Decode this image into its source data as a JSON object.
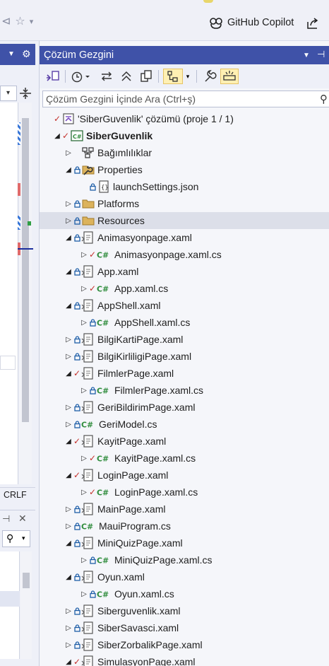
{
  "top": {
    "copilot_label": "GitHub Copilot"
  },
  "left": {
    "footer_text": "CRLF"
  },
  "explorer": {
    "title": "Çözüm Gezgini",
    "search_placeholder": "Çözüm Gezgini İçinde Ara (Ctrl+ş)",
    "colors": {
      "header_bg": "#3f52a8",
      "check": "#c4302b",
      "lock": "#1f5fa8",
      "csharp": "#2f8c3c",
      "active_tool": "#fff0b3"
    },
    "toolbar": [
      {
        "name": "switch-views-icon"
      },
      {
        "name": "history-icon"
      },
      {
        "name": "sync-icon"
      },
      {
        "name": "collapse-all-icon"
      },
      {
        "name": "copy-icon"
      },
      {
        "name": "show-all-files-icon",
        "active": true
      },
      {
        "name": "properties-wrench-icon"
      },
      {
        "name": "preview-selected-icon",
        "active": true
      }
    ],
    "tree": [
      {
        "label": "'SiberGuvenlik' çözümü (proje 1 / 1)",
        "level": 0,
        "expander": "",
        "status": "check",
        "icon": "solution"
      },
      {
        "label": "SiberGuvenlik",
        "level": 1,
        "expander": "expanded",
        "status": "check",
        "icon": "csproj",
        "bold": true
      },
      {
        "label": "Bağımlılıklar",
        "level": 2,
        "expander": "collapsed",
        "status": "",
        "icon": "dependencies"
      },
      {
        "label": "Properties",
        "level": 2,
        "expander": "expanded",
        "status": "lock",
        "icon": "properties-folder"
      },
      {
        "label": "launchSettings.json",
        "level": 3,
        "expander": "",
        "status": "lock",
        "icon": "json"
      },
      {
        "label": "Platforms",
        "level": 2,
        "expander": "collapsed",
        "status": "lock",
        "icon": "folder"
      },
      {
        "label": "Resources",
        "level": 2,
        "expander": "collapsed",
        "status": "lock",
        "icon": "folder",
        "selected": true
      },
      {
        "label": "Animasyonpage.xaml",
        "level": 2,
        "expander": "expanded",
        "status": "lock",
        "icon": "xaml"
      },
      {
        "label": "Animasyonpage.xaml.cs",
        "level": 3,
        "expander": "collapsed",
        "status": "check",
        "icon": "cs"
      },
      {
        "label": "App.xaml",
        "level": 2,
        "expander": "expanded",
        "status": "lock",
        "icon": "xaml"
      },
      {
        "label": "App.xaml.cs",
        "level": 3,
        "expander": "collapsed",
        "status": "check",
        "icon": "cs"
      },
      {
        "label": "AppShell.xaml",
        "level": 2,
        "expander": "expanded",
        "status": "lock",
        "icon": "xaml"
      },
      {
        "label": "AppShell.xaml.cs",
        "level": 3,
        "expander": "collapsed",
        "status": "lock",
        "icon": "cs"
      },
      {
        "label": "BilgiKartiPage.xaml",
        "level": 2,
        "expander": "collapsed",
        "status": "lock",
        "icon": "xaml"
      },
      {
        "label": "BilgiKirliligiPage.xaml",
        "level": 2,
        "expander": "collapsed",
        "status": "lock",
        "icon": "xaml"
      },
      {
        "label": "FilmlerPage.xaml",
        "level": 2,
        "expander": "expanded",
        "status": "check",
        "icon": "xaml"
      },
      {
        "label": "FilmlerPage.xaml.cs",
        "level": 3,
        "expander": "collapsed",
        "status": "lock",
        "icon": "cs"
      },
      {
        "label": "GeriBildirimPage.xaml",
        "level": 2,
        "expander": "collapsed",
        "status": "lock",
        "icon": "xaml"
      },
      {
        "label": "GeriModel.cs",
        "level": 2,
        "expander": "collapsed",
        "status": "lock",
        "icon": "cs"
      },
      {
        "label": "KayitPage.xaml",
        "level": 2,
        "expander": "expanded",
        "status": "check",
        "icon": "xaml"
      },
      {
        "label": "KayitPage.xaml.cs",
        "level": 3,
        "expander": "collapsed",
        "status": "check",
        "icon": "cs"
      },
      {
        "label": "LoginPage.xaml",
        "level": 2,
        "expander": "expanded",
        "status": "check",
        "icon": "xaml"
      },
      {
        "label": "LoginPage.xaml.cs",
        "level": 3,
        "expander": "collapsed",
        "status": "check",
        "icon": "cs"
      },
      {
        "label": "MainPage.xaml",
        "level": 2,
        "expander": "collapsed",
        "status": "lock",
        "icon": "xaml"
      },
      {
        "label": "MauiProgram.cs",
        "level": 2,
        "expander": "collapsed",
        "status": "lock",
        "icon": "cs"
      },
      {
        "label": "MiniQuizPage.xaml",
        "level": 2,
        "expander": "expanded",
        "status": "lock",
        "icon": "xaml"
      },
      {
        "label": "MiniQuizPage.xaml.cs",
        "level": 3,
        "expander": "collapsed",
        "status": "lock",
        "icon": "cs"
      },
      {
        "label": "Oyun.xaml",
        "level": 2,
        "expander": "expanded",
        "status": "lock",
        "icon": "xaml"
      },
      {
        "label": "Oyun.xaml.cs",
        "level": 3,
        "expander": "collapsed",
        "status": "lock",
        "icon": "cs"
      },
      {
        "label": "Siberguvenlik.xaml",
        "level": 2,
        "expander": "collapsed",
        "status": "lock",
        "icon": "xaml"
      },
      {
        "label": "SiberSavasci.xaml",
        "level": 2,
        "expander": "collapsed",
        "status": "lock",
        "icon": "xaml"
      },
      {
        "label": "SiberZorbalikPage.xaml",
        "level": 2,
        "expander": "collapsed",
        "status": "lock",
        "icon": "xaml"
      },
      {
        "label": "SimulasyonPage.xaml",
        "level": 2,
        "expander": "expanded",
        "status": "check",
        "icon": "xaml"
      }
    ]
  }
}
